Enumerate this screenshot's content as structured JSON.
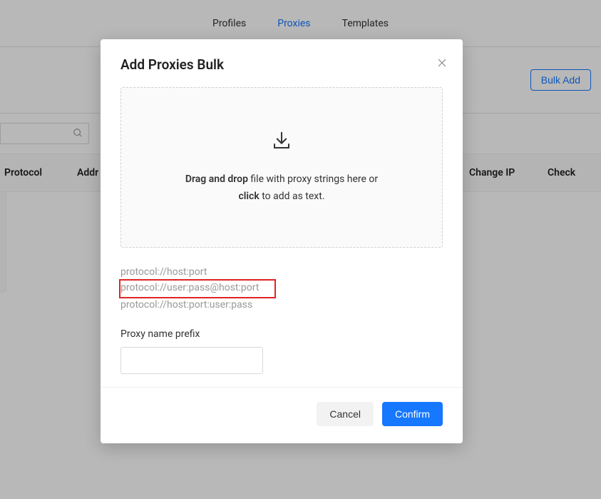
{
  "nav": {
    "tabs": [
      "Profiles",
      "Proxies",
      "Templates"
    ],
    "active": "Proxies"
  },
  "toolbar": {
    "bulk_add_label": "Bulk Add"
  },
  "table": {
    "columns": {
      "protocol": "Protocol",
      "addr": "Addr",
      "change_ip": "Change IP",
      "check": "Check"
    }
  },
  "modal": {
    "title": "Add Proxies Bulk",
    "dropzone": {
      "strong1": "Drag and drop",
      "mid": " file with proxy strings here or ",
      "strong2": "click",
      "tail": " to add as text."
    },
    "formats": [
      "protocol://host:port",
      "protocol://user:pass@host:port",
      "protocol://host:port:user:pass"
    ],
    "highlighted_format_index": 1,
    "prefix_label": "Proxy name prefix",
    "buttons": {
      "cancel": "Cancel",
      "confirm": "Confirm"
    }
  }
}
